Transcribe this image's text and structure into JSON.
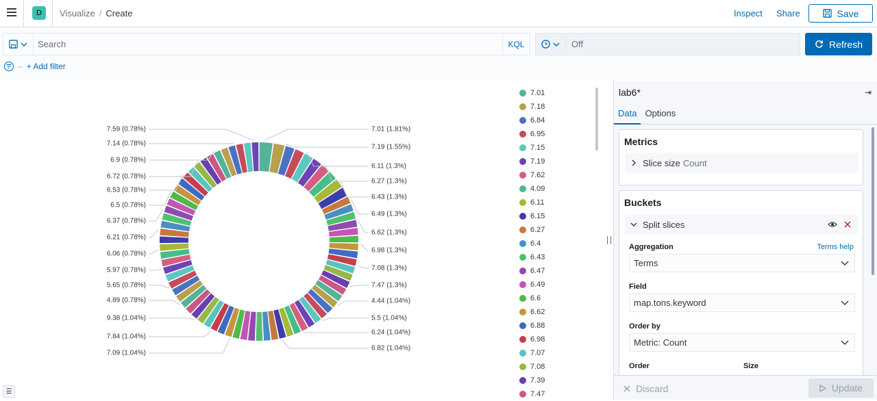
{
  "header": {
    "app_badge": "D",
    "breadcrumb_1": "Visualize",
    "breadcrumb_2": "Create",
    "inspect": "Inspect",
    "share": "Share",
    "save": "Save"
  },
  "query": {
    "search_placeholder": "Search",
    "kql": "KQL",
    "time_value": "Off",
    "refresh": "Refresh",
    "add_filter": "+ Add filter"
  },
  "sidebar": {
    "title": "lab6*",
    "tabs": [
      "Data",
      "Options"
    ],
    "metrics_title": "Metrics",
    "metric_label": "Slice size",
    "metric_value": "Count",
    "buckets_title": "Buckets",
    "bucket_label": "Split slices",
    "aggregation_label": "Aggregation",
    "terms_help": "Terms help",
    "aggregation_value": "Terms",
    "field_label": "Field",
    "field_value": "map.tons.keyword",
    "orderby_label": "Order by",
    "orderby_value": "Metric: Count",
    "order_label": "Order",
    "size_label": "Size",
    "discard": "Discard",
    "update": "Update"
  },
  "colors": {
    "accent": "#006bb4",
    "palette": [
      "#54b399",
      "#b9a04f",
      "#4a72c4",
      "#c54c5a",
      "#5cc7c1",
      "#6e43b5",
      "#d3607f",
      "#46be88",
      "#a6b838",
      "#3d3dac",
      "#c7793d",
      "#4a8fc4",
      "#50c26e",
      "#8f4bb0",
      "#c455b5",
      "#4fba4a",
      "#c4953d",
      "#3f6ac4",
      "#c43f4e",
      "#5ac3bf",
      "#96b846",
      "#6a3fb0",
      "#c95885"
    ]
  },
  "legend": [
    "7.01",
    "7.18",
    "6.84",
    "6.95",
    "7.15",
    "7.19",
    "7.62",
    "4.09",
    "6.11",
    "6.15",
    "6.27",
    "6.4",
    "6.43",
    "6.47",
    "6.49",
    "6.6",
    "6.62",
    "6.88",
    "6.98",
    "7.07",
    "7.08",
    "7.39",
    "7.47"
  ],
  "chart_data": {
    "type": "pie",
    "donut": true,
    "slice_count": 75,
    "labels_right": [
      "7.01 (1.81%)",
      "7.19 (1.55%)",
      "6.11 (1.3%)",
      "6.27 (1.3%)",
      "6.43 (1.3%)",
      "6.49 (1.3%)",
      "6.62 (1.3%)",
      "6.98 (1.3%)",
      "7.08 (1.3%)",
      "7.47 (1.3%)",
      "4.44 (1.04%)",
      "5.5 (1.04%)",
      "6.24 (1.04%)",
      "6.82 (1.04%)"
    ],
    "labels_left": [
      "7.59 (0.78%)",
      "7.14 (0.78%)",
      "6.9 (0.78%)",
      "6.72 (0.78%)",
      "6.53 (0.78%)",
      "6.5 (0.78%)",
      "6.37 (0.78%)",
      "6.21 (0.78%)",
      "6.06 (0.78%)",
      "5.97 (0.78%)",
      "5.65 (0.78%)",
      "4.89 (0.78%)",
      "9.38 (1.04%)",
      "7.84 (1.04%)",
      "7.09 (1.04%)"
    ],
    "values_right": [
      1.81,
      1.55,
      1.3,
      1.3,
      1.3,
      1.3,
      1.3,
      1.3,
      1.3,
      1.3,
      1.04,
      1.04,
      1.04,
      1.04
    ],
    "values_left": [
      0.78,
      0.78,
      0.78,
      0.78,
      0.78,
      0.78,
      0.78,
      0.78,
      0.78,
      0.78,
      0.78,
      0.78,
      1.04,
      1.04,
      1.04
    ]
  }
}
